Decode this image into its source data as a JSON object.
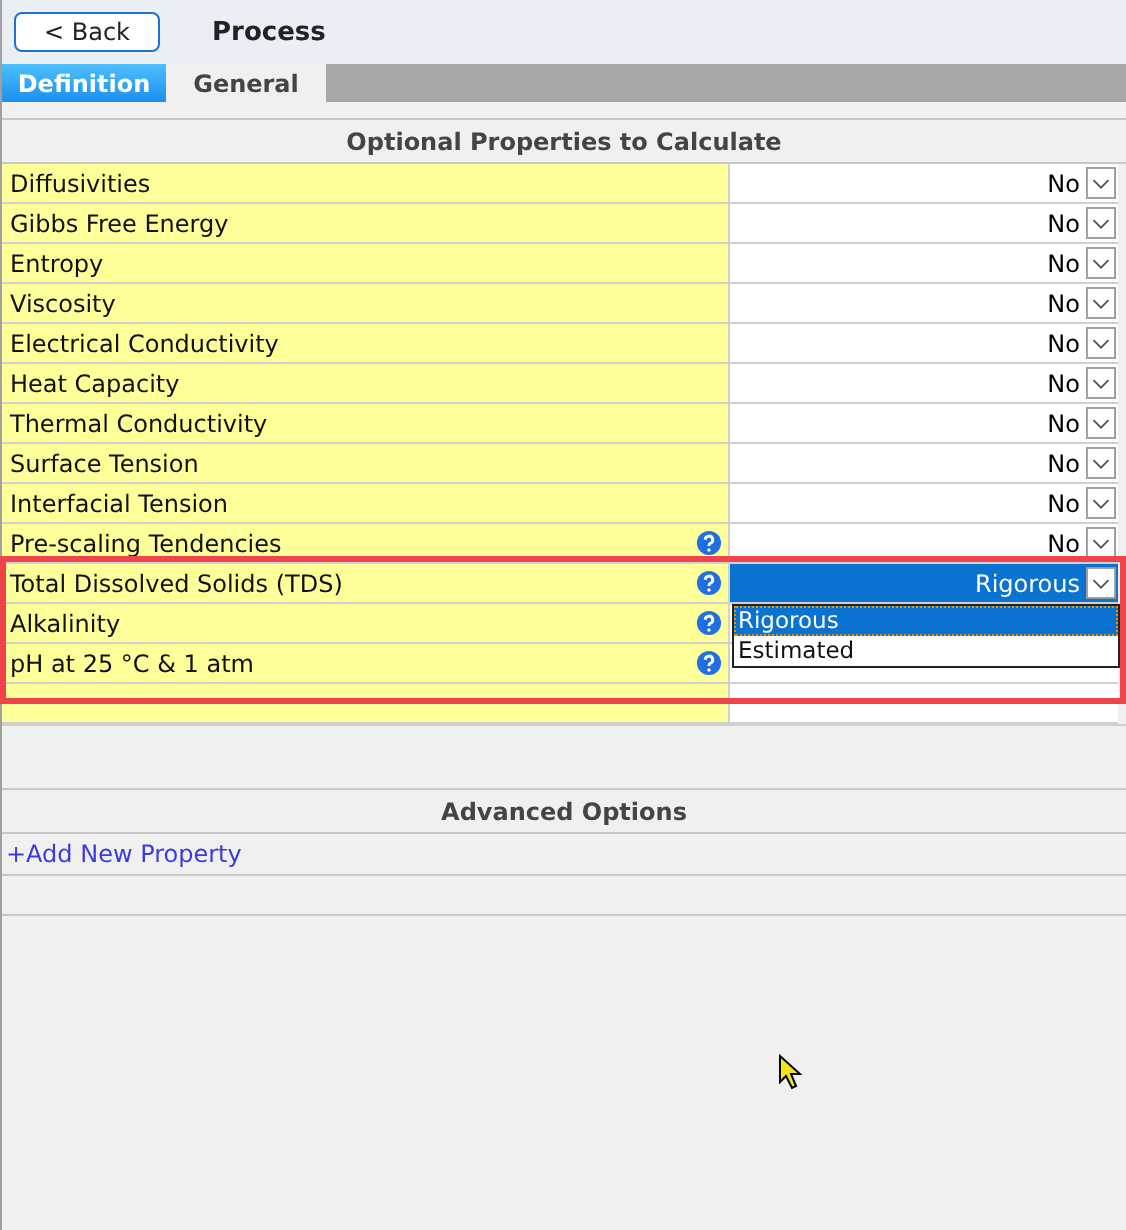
{
  "header": {
    "back_button": "< Back",
    "title": "Process"
  },
  "tabs": [
    {
      "label": "Definition",
      "selected": true
    },
    {
      "label": "General",
      "selected": false
    }
  ],
  "optional_properties": {
    "heading": "Optional Properties to Calculate",
    "rows": [
      {
        "name": "Diffusivities",
        "value": "No",
        "help": false
      },
      {
        "name": "Gibbs Free Energy",
        "value": "No",
        "help": false
      },
      {
        "name": "Entropy",
        "value": "No",
        "help": false
      },
      {
        "name": "Viscosity",
        "value": "No",
        "help": false
      },
      {
        "name": "Electrical Conductivity",
        "value": "No",
        "help": false
      },
      {
        "name": "Heat Capacity",
        "value": "No",
        "help": false
      },
      {
        "name": "Thermal Conductivity",
        "value": "No",
        "help": false
      },
      {
        "name": "Surface Tension",
        "value": "No",
        "help": false
      },
      {
        "name": "Interfacial Tension",
        "value": "No",
        "help": false
      },
      {
        "name": "Pre-scaling Tendencies",
        "value": "No",
        "help": true
      },
      {
        "name": "Total Dissolved Solids (TDS)",
        "value": "Rigorous",
        "help": true,
        "selected": true,
        "open": true,
        "options": [
          {
            "label": "Rigorous",
            "selected": true
          },
          {
            "label": "Estimated",
            "selected": false
          }
        ]
      },
      {
        "name": "Alkalinity",
        "help": true
      },
      {
        "name": "pH at 25 °C & 1 atm",
        "help": true
      }
    ]
  },
  "advanced_options": {
    "heading": "Advanced Options",
    "link": "+Add New Property"
  }
}
